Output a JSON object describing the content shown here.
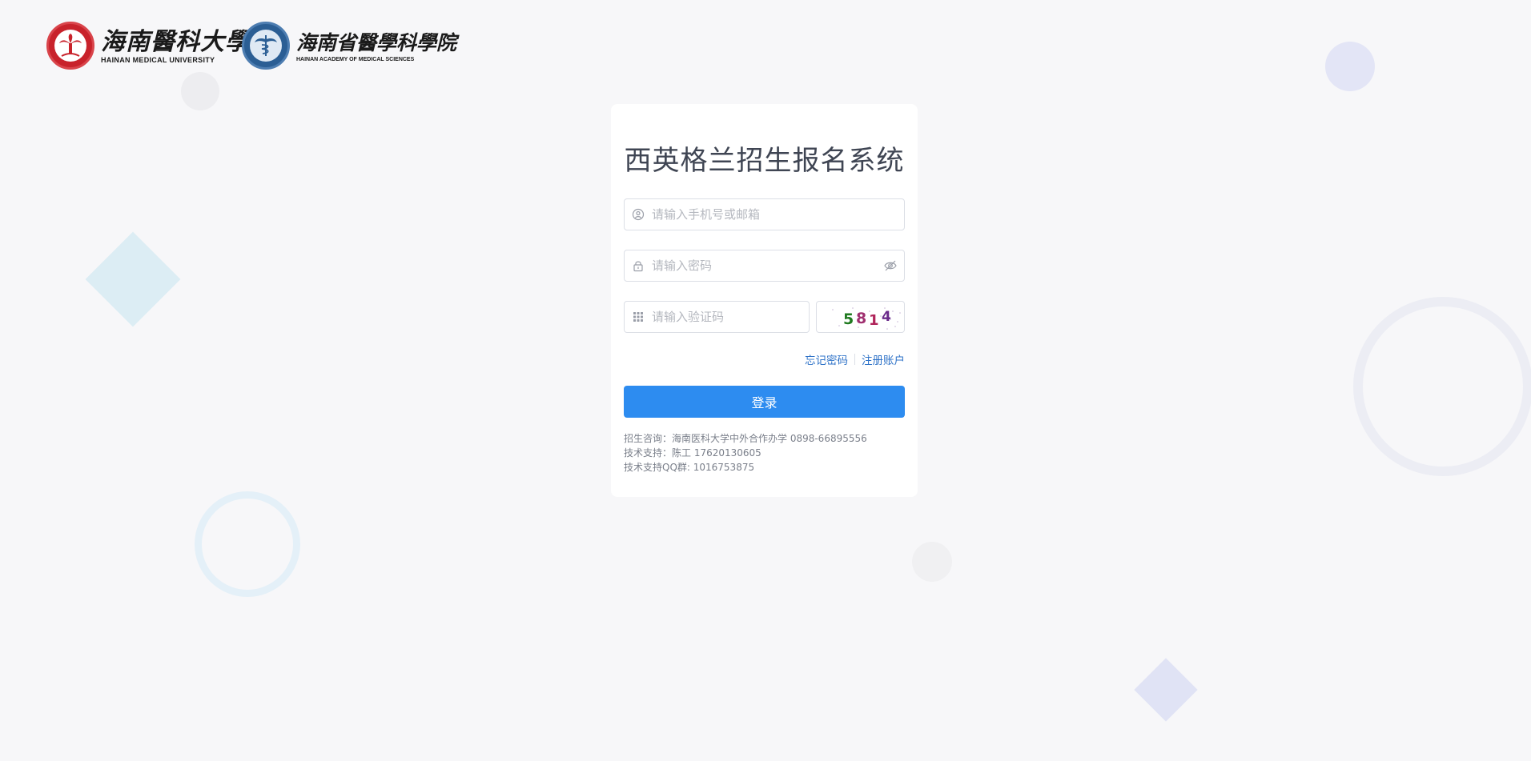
{
  "header": {
    "logo_hmu": {
      "name_cn": "海南醫科大學",
      "name_en": "HAINAN MEDICAL UNIVERSITY"
    },
    "logo_haoms": {
      "name_cn": "海南省醫學科學院",
      "name_en": "HAINAN ACADEMY OF MEDICAL SCIENCES"
    }
  },
  "login": {
    "title": "西英格兰招生报名系统",
    "phone_placeholder": "请输入手机号或邮箱",
    "password_placeholder": "请输入密码",
    "captcha_placeholder": "请输入验证码",
    "captcha_code": [
      "5",
      "8",
      "1",
      "4"
    ],
    "forgot_password": "忘记密码",
    "register": "注册账户",
    "login_button": "登录",
    "info": [
      "招生咨询：海南医科大学中外合作办学 0898-66895556",
      "技术支持：陈工 17620130605",
      "技术支持QQ群: 1016753875"
    ]
  },
  "icons": {
    "phone_field": "user-circle-icon",
    "password_field": "lock-icon",
    "password_toggle": "eye-off-icon",
    "captcha_field": "grid-icon"
  },
  "colors": {
    "primary": "#2d8cf0",
    "link": "#2f73c8",
    "hmu_red": "#c8222b",
    "haoms_blue": "#2b5e94",
    "captcha_digits": [
      "#1f7a1f",
      "#a03070",
      "#b0245a",
      "#6a2a8a"
    ]
  }
}
